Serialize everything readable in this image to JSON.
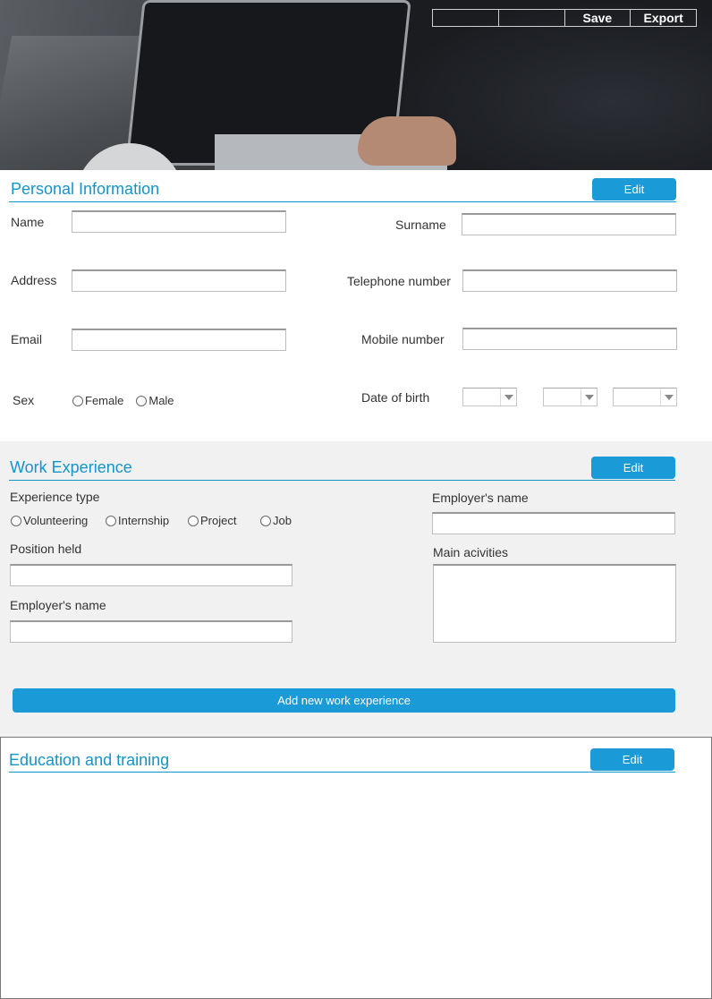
{
  "toolbar": {
    "blank_1": "",
    "blank_2": "",
    "save_label": "Save",
    "export_label": "Export"
  },
  "personal": {
    "title": "Personal Information",
    "edit_label": "Edit",
    "name_label": "Name",
    "surname_label": "Surname",
    "address_label": "Address",
    "telephone_label": "Telephone number",
    "email_label": "Email",
    "mobile_label": "Mobile number",
    "sex_label": "Sex",
    "sex_options": [
      "Female",
      "Male"
    ],
    "dob_label": "Date of birth"
  },
  "work": {
    "title": "Work Experience",
    "edit_label": "Edit",
    "experience_type_label": "Experience type",
    "experience_types": [
      "Volunteering",
      "Internship",
      "Project",
      "Job"
    ],
    "position_label": "Position held",
    "employer_label_left": "Employer's name",
    "employer_label_right": "Employer's name",
    "activities_label": "Main acivities",
    "add_label": "Add new work experience"
  },
  "education": {
    "title": "Education and training",
    "edit_label": "Edit"
  },
  "colors": {
    "accent": "#1a9ad6",
    "title": "#1694c8",
    "work_bg": "#f1f1f1"
  }
}
